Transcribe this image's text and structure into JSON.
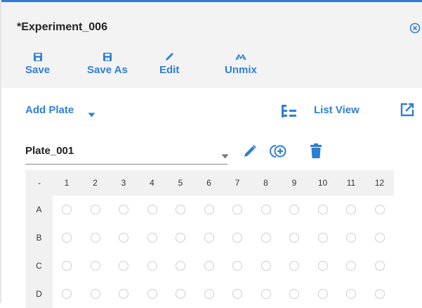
{
  "window": {
    "title": "*Experiment_006"
  },
  "icons": {
    "close": "close-circle-icon",
    "save": "floppy-disk-icon",
    "save_as": "floppy-disk-plus-icon",
    "edit": "pencil-icon",
    "unmix": "unmix-icon",
    "list_view": "tree-list-icon",
    "popout": "open-external-icon",
    "add_well": "add-circle-icon",
    "delete": "trash-icon"
  },
  "toolbar": {
    "save_label": "Save",
    "save_as_label": "Save As",
    "edit_label": "Edit",
    "unmix_label": "Unmix"
  },
  "plate_bar": {
    "add_plate_label": "Add Plate",
    "list_view_label": "List View"
  },
  "plate_select": {
    "value": "Plate_001"
  },
  "grid": {
    "corner": "-",
    "columns": [
      "1",
      "2",
      "3",
      "4",
      "5",
      "6",
      "7",
      "8",
      "9",
      "10",
      "11",
      "12"
    ],
    "rows": [
      "A",
      "B",
      "C",
      "D"
    ]
  },
  "colors": {
    "accent": "#2f7fd3",
    "header_bg": "#f1f1f1",
    "toolbar_bg": "#f3f3f3"
  }
}
